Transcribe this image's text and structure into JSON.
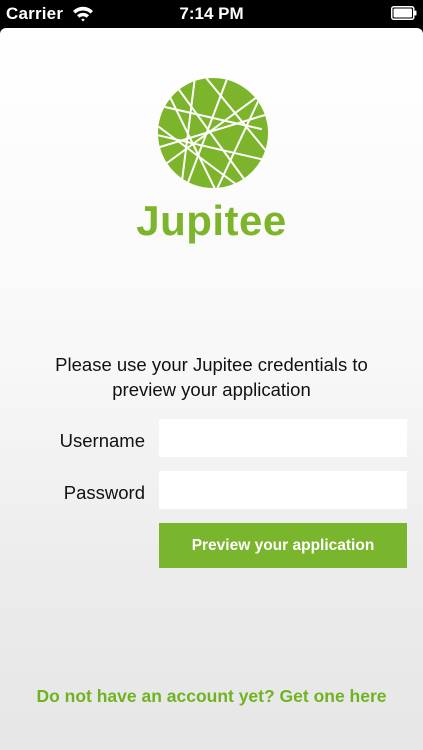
{
  "status_bar": {
    "carrier": "Carrier",
    "time": "7:14 PM"
  },
  "brand": {
    "name": "Jupitee",
    "color": "#7cb52b"
  },
  "login": {
    "instructions": "Please use your Jupitee credentials to preview your application",
    "username_label": "Username",
    "username_value": "",
    "password_label": "Password",
    "password_value": "",
    "submit_label": "Preview your application",
    "signup_link": "Do not have an account yet? Get one here"
  },
  "icons": {
    "wifi": "wifi-icon",
    "battery": "battery-icon",
    "logo": "jupitee-logo-icon"
  }
}
